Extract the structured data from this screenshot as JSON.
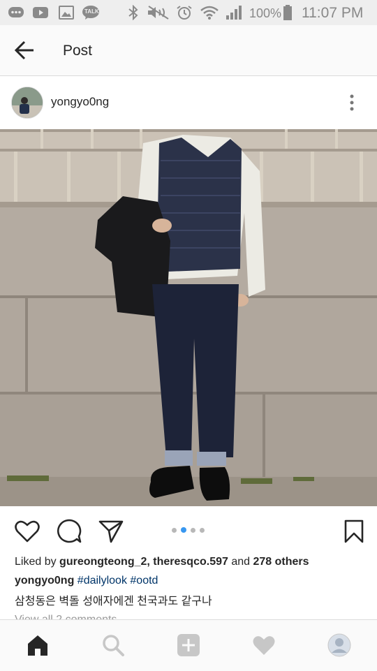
{
  "status_bar": {
    "battery": "100%",
    "time": "11:07 PM",
    "icons": [
      "message-icon",
      "youtube-icon",
      "gallery-icon",
      "kakaotalk-icon",
      "bluetooth-icon",
      "mute-icon",
      "alarm-icon",
      "wifi-icon",
      "signal-icon",
      "battery-icon"
    ],
    "talk_label": "TALK"
  },
  "header": {
    "title": "Post"
  },
  "post": {
    "username": "yongyo0ng",
    "likes": {
      "prefix": "Liked by ",
      "user1": "gureongteong_2",
      "sep": ", ",
      "user2": "theresqco.597",
      "and": " and ",
      "others": "278 others"
    },
    "caption": {
      "user": "yongyo0ng",
      "tag1": "#dailylook",
      "tag2": "#ootd",
      "text": "삼청동은 벽돌 성애자에겐 천국과도 같구나"
    },
    "comments_link": "View all 2 comments",
    "carousel": {
      "count": 4,
      "active": 2
    }
  },
  "colors": {
    "accent": "#3897f0",
    "hashtag": "#003569",
    "text": "#262626"
  },
  "bottom_nav": [
    "home-icon",
    "search-icon",
    "add-icon",
    "heart-icon",
    "profile-icon"
  ]
}
